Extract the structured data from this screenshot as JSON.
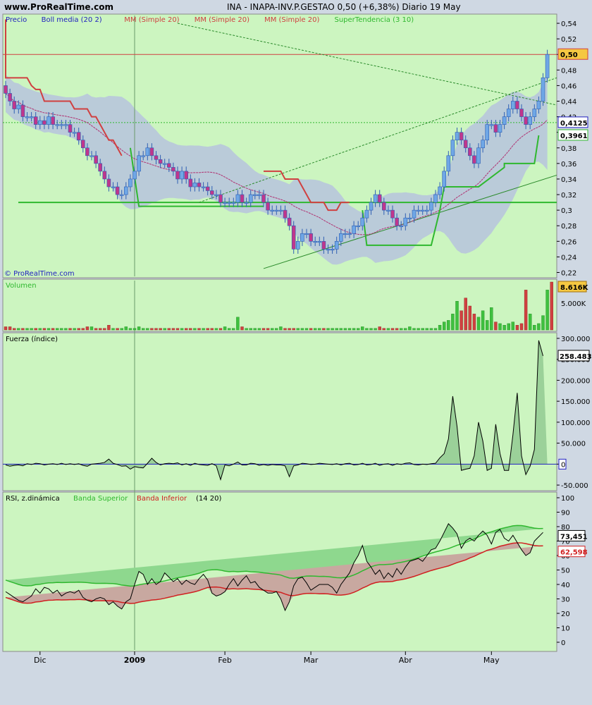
{
  "header": {
    "site": "www.ProRealTime.com",
    "title": "INA - INAPA-INV.P.GESTAO    0,50 (+6,38%)   Diario  19 May",
    "watermark": "© ProRealTime.com"
  },
  "colors": {
    "panel_bg": "#ccf5c0",
    "page_bg": "#cfd8e3",
    "bull": "#2f5fb3",
    "bear": "#c0368c",
    "boll_band": "#b6c3dd",
    "red": "#d04040",
    "green": "#2fb82f",
    "dark_green": "#1c8a1c",
    "blue": "#2020c0"
  },
  "price_panel": {
    "legend": [
      {
        "text": "Precio",
        "color": "#2020c0"
      },
      {
        "text": "Boll media (20 2)",
        "color": "#2020c0"
      },
      {
        "text": "MM (Simple 20)",
        "color": "#d04040"
      },
      {
        "text": "MM (Simple 20)",
        "color": "#d04040"
      },
      {
        "text": "MM (Simple 20)",
        "color": "#d04040"
      },
      {
        "text": "SuperTendencia (3 10)",
        "color": "#2fb82f"
      }
    ],
    "ticks": [
      "0,54",
      "0,52",
      "0,5",
      "0,48",
      "0,46",
      "0,44",
      "0,42",
      "0,4",
      "0,38",
      "0,36",
      "0,34",
      "0,32",
      "0,3",
      "0,28",
      "0,26",
      "0,24",
      "0,22"
    ],
    "labels": [
      {
        "text": "0,50",
        "value": 0.5,
        "bg": "#f5c842",
        "border": "#d04040"
      },
      {
        "text": "0,4125",
        "value": 0.4125,
        "bg": "#ffffff",
        "border": "#2020c0"
      },
      {
        "text": "0,3961",
        "value": 0.3961,
        "bg": "#ffffff",
        "border": "#2fb82f"
      }
    ]
  },
  "volume_panel": {
    "title": "Volumen",
    "ticks": [
      "5.000K"
    ],
    "last_label": "8.616K"
  },
  "force_panel": {
    "title": "Fuerza (índice)",
    "ticks": [
      "300.000",
      "250.000",
      "200.000",
      "150.000",
      "100.000",
      "50.000",
      "0",
      "-50.000"
    ],
    "last_label": "258.483"
  },
  "rsi_panel": {
    "title_parts": [
      {
        "text": "RSI, z.dinámica ",
        "color": "#000000"
      },
      {
        "text": "Banda Superior ",
        "color": "#2fb82f"
      },
      {
        "text": "Banda Inferior",
        "color": "#d02020"
      },
      {
        "text": " (14 20)",
        "color": "#000000"
      }
    ],
    "ticks": [
      "100",
      "90",
      "80",
      "70",
      "60",
      "50",
      "40",
      "30",
      "20",
      "10",
      "0"
    ],
    "labels": [
      {
        "text": "73,451",
        "value": 73.451,
        "bg": "#ffffff",
        "border": "#000000",
        "color": "#000000"
      },
      {
        "text": "62,598",
        "value": 62.598,
        "bg": "#ffffff",
        "border": "#d02020",
        "color": "#d02020"
      }
    ]
  },
  "x_axis": {
    "labels": [
      {
        "text": "Dic",
        "index": 8,
        "bold": false
      },
      {
        "text": "2009",
        "index": 30,
        "bold": true
      },
      {
        "text": "Feb",
        "index": 51,
        "bold": false
      },
      {
        "text": "Mar",
        "index": 71,
        "bold": false
      },
      {
        "text": "Abr",
        "index": 93,
        "bold": false
      },
      {
        "text": "May",
        "index": 113,
        "bold": false
      }
    ]
  },
  "chart_data": {
    "type": "candlestick",
    "price_ylim": [
      0.215,
      0.55
    ],
    "horizontal_lines": [
      {
        "value": 0.5,
        "color": "#d04040",
        "style": "solid"
      },
      {
        "value": 0.4125,
        "color": "#2fb82f",
        "style": "dashed"
      },
      {
        "value": 0.31,
        "color": "#2fb82f",
        "style": "solid"
      }
    ],
    "closes": [
      0.45,
      0.44,
      0.43,
      0.435,
      0.42,
      0.42,
      0.42,
      0.41,
      0.415,
      0.41,
      0.42,
      0.41,
      0.41,
      0.41,
      0.41,
      0.4,
      0.4,
      0.39,
      0.38,
      0.37,
      0.37,
      0.36,
      0.35,
      0.34,
      0.33,
      0.33,
      0.32,
      0.32,
      0.33,
      0.34,
      0.35,
      0.37,
      0.37,
      0.38,
      0.37,
      0.365,
      0.36,
      0.36,
      0.355,
      0.35,
      0.34,
      0.35,
      0.34,
      0.33,
      0.335,
      0.33,
      0.33,
      0.325,
      0.32,
      0.32,
      0.31,
      0.31,
      0.31,
      0.31,
      0.32,
      0.31,
      0.31,
      0.32,
      0.32,
      0.32,
      0.31,
      0.3,
      0.3,
      0.3,
      0.3,
      0.29,
      0.28,
      0.25,
      0.26,
      0.27,
      0.27,
      0.26,
      0.26,
      0.26,
      0.25,
      0.25,
      0.25,
      0.26,
      0.27,
      0.27,
      0.27,
      0.28,
      0.28,
      0.29,
      0.3,
      0.31,
      0.32,
      0.31,
      0.3,
      0.3,
      0.29,
      0.28,
      0.28,
      0.29,
      0.29,
      0.3,
      0.3,
      0.3,
      0.3,
      0.31,
      0.32,
      0.33,
      0.35,
      0.37,
      0.39,
      0.4,
      0.39,
      0.38,
      0.37,
      0.36,
      0.38,
      0.39,
      0.41,
      0.41,
      0.4,
      0.41,
      0.42,
      0.43,
      0.44,
      0.43,
      0.42,
      0.41,
      0.42,
      0.43,
      0.44,
      0.47,
      0.5
    ],
    "volume": [
      2,
      2,
      1,
      1,
      1,
      1,
      1,
      1,
      1,
      1,
      1,
      1,
      1,
      1,
      1,
      1,
      1,
      1,
      1,
      2,
      2,
      1,
      1,
      1,
      3,
      1,
      1,
      1,
      2,
      1,
      1,
      2,
      1,
      1,
      1,
      1,
      1,
      1,
      1,
      1,
      1,
      1,
      1,
      1,
      1,
      1,
      1,
      1,
      1,
      1,
      1,
      2,
      1,
      1,
      8,
      2,
      1,
      1,
      1,
      1,
      1,
      1,
      1,
      1,
      2,
      1,
      1,
      1,
      1,
      1,
      1,
      1,
      1,
      1,
      1,
      1,
      1,
      1,
      1,
      1,
      1,
      1,
      1,
      2,
      1,
      1,
      1,
      2,
      1,
      1,
      1,
      1,
      1,
      1,
      2,
      1,
      1,
      1,
      1,
      1,
      1,
      3,
      5,
      6,
      10,
      18,
      12,
      20,
      15,
      10,
      8,
      12,
      6,
      14,
      5,
      4,
      3,
      4,
      5,
      3,
      4,
      25,
      10,
      3,
      4,
      9,
      25,
      8616
    ],
    "force": [
      -2,
      -5,
      -3,
      -2,
      -4,
      1,
      -1,
      2,
      1,
      -2,
      0,
      1,
      -1,
      2,
      -1,
      1,
      -1,
      1,
      -3,
      -5,
      0,
      1,
      2,
      4,
      12,
      2,
      -1,
      -5,
      -4,
      -12,
      -6,
      -8,
      -9,
      2,
      14,
      4,
      -2,
      1,
      2,
      1,
      3,
      -2,
      1,
      -3,
      2,
      -1,
      -2,
      -3,
      1,
      -4,
      -37,
      -2,
      -4,
      0,
      5,
      -2,
      -2,
      2,
      1,
      -3,
      -1,
      -3,
      -1,
      -2,
      -2,
      -4,
      -30,
      -4,
      -2,
      2,
      1,
      -1,
      0,
      2,
      1,
      0,
      -1,
      1,
      -2,
      1,
      2,
      -2,
      -1,
      2,
      -2,
      -1,
      2,
      -3,
      0,
      1,
      -3,
      1,
      -1,
      2,
      3,
      -1,
      -2,
      0,
      -1,
      1,
      2,
      15,
      25,
      60,
      162,
      90,
      -15,
      -12,
      -10,
      20,
      100,
      55,
      -15,
      -10,
      95,
      25,
      -15,
      -15,
      70,
      170,
      20,
      -25,
      -5,
      35,
      295,
      258
    ],
    "rsi": [
      35,
      33,
      31,
      29,
      28,
      30,
      32,
      37,
      34,
      38,
      37,
      34,
      36,
      32,
      34,
      35,
      34,
      36,
      31,
      29,
      28,
      30,
      31,
      30,
      26,
      28,
      25,
      23,
      28,
      30,
      40,
      49,
      47,
      40,
      44,
      40,
      42,
      48,
      45,
      42,
      44,
      40,
      43,
      41,
      40,
      44,
      47,
      43,
      34,
      32,
      33,
      35,
      40,
      44,
      39,
      43,
      46,
      41,
      42,
      38,
      36,
      34,
      34,
      35,
      30,
      22,
      28,
      39,
      44,
      45,
      41,
      36,
      38,
      40,
      40,
      40,
      38,
      34,
      40,
      44,
      48,
      55,
      60,
      67,
      56,
      52,
      47,
      50,
      44,
      48,
      45,
      51,
      47,
      52,
      56,
      57,
      58,
      56,
      60,
      64,
      65,
      70,
      76,
      82,
      79,
      75,
      65,
      70,
      72,
      70,
      74,
      77,
      74,
      68,
      76,
      78,
      72,
      70,
      74,
      69,
      64,
      60,
      62,
      70,
      73,
      76
    ]
  }
}
